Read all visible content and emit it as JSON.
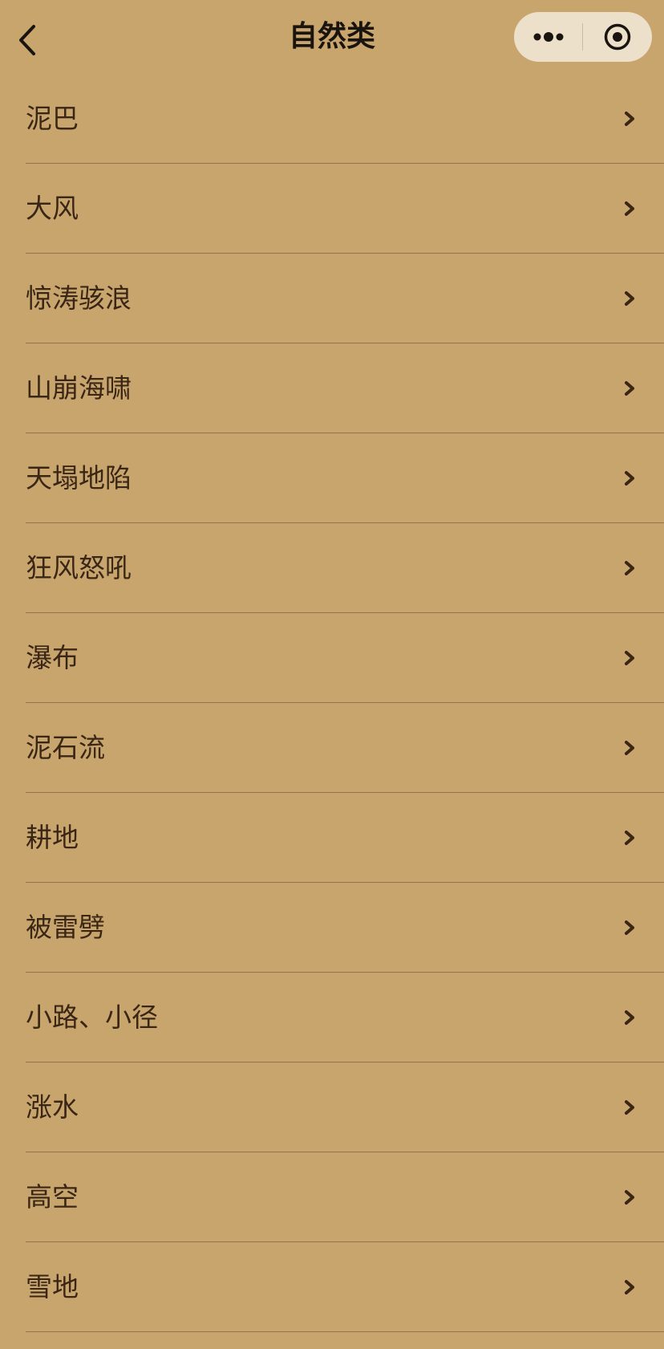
{
  "header": {
    "title": "自然类",
    "back_icon": "chevron-left-icon",
    "more_icon": "more-dots-icon",
    "close_icon": "target-close-icon"
  },
  "colors": {
    "background": "#c9a56e",
    "text": "#3a2614",
    "divider": "#8f7450",
    "capsule": "#ece0cb"
  },
  "list": {
    "chevron_icon": "chevron-right-icon",
    "items": [
      {
        "label": "泥巴"
      },
      {
        "label": "大风"
      },
      {
        "label": "惊涛骇浪"
      },
      {
        "label": "山崩海啸"
      },
      {
        "label": "天塌地陷"
      },
      {
        "label": "狂风怒吼"
      },
      {
        "label": "瀑布"
      },
      {
        "label": "泥石流"
      },
      {
        "label": "耕地"
      },
      {
        "label": "被雷劈"
      },
      {
        "label": "小路、小径"
      },
      {
        "label": "涨水"
      },
      {
        "label": "高空"
      },
      {
        "label": "雪地"
      }
    ]
  }
}
